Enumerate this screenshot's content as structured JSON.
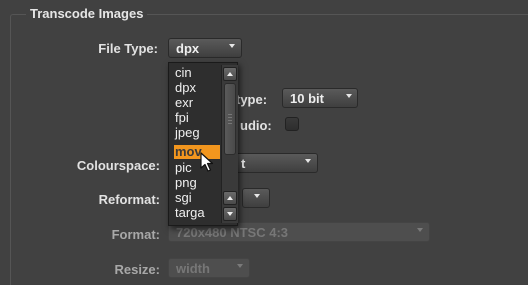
{
  "group": {
    "title": "Transcode Images"
  },
  "file_type": {
    "label": "File Type:",
    "value": "dpx"
  },
  "data_type": {
    "label_suffix": "type:",
    "value": "10 bit"
  },
  "audio": {
    "label_suffix": "udio:"
  },
  "colourspace": {
    "label": "Colourspace:",
    "value_suffix": "t"
  },
  "reformat": {
    "label": "Reformat:"
  },
  "format": {
    "label": "Format:",
    "value": "720x480 NTSC 4:3"
  },
  "resize": {
    "label": "Resize:",
    "value": "width"
  },
  "dropdown": {
    "options": [
      "cin",
      "dpx",
      "exr",
      "fpi",
      "jpeg",
      "mov",
      "pic",
      "png",
      "sgi",
      "targa"
    ],
    "highlighted": "mov",
    "highlight_color": "#f2961e"
  }
}
